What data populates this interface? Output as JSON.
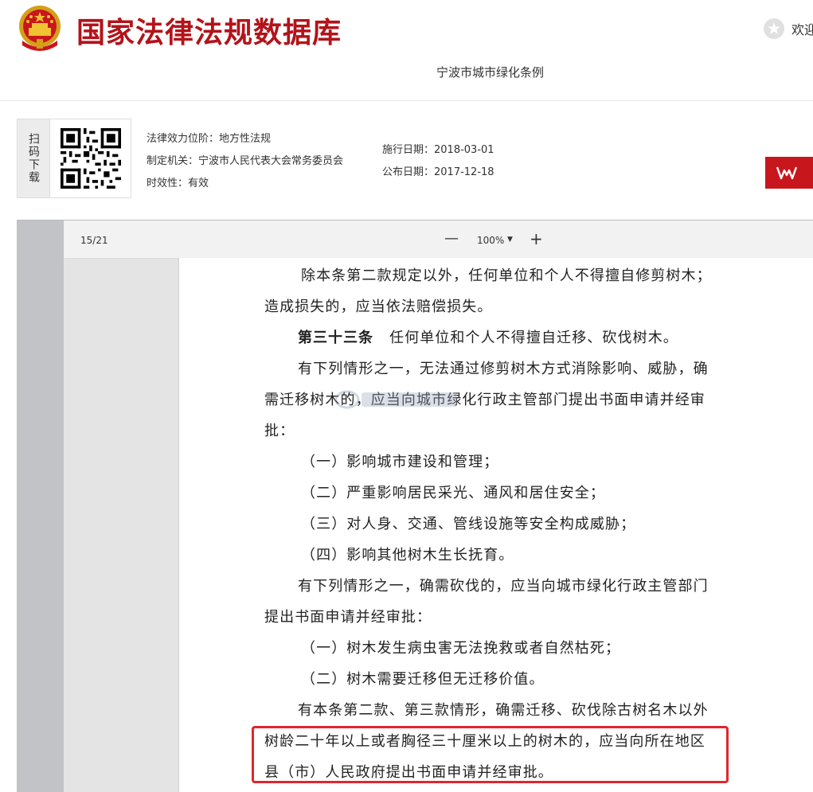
{
  "header": {
    "site_title": "国家法律法规数据库",
    "welcome": "欢迎",
    "doc_title": "宁波市城市绿化条例",
    "emblem_icon": "national-emblem-icon",
    "brand_color": "#b3131a"
  },
  "info": {
    "scan_label": "扫码下载",
    "effect_level": "法律效力位阶：地方性法规",
    "issuing_body": "制定机关：宁波市人民代表大会常务委员会",
    "validity": "时效性：有效",
    "effective_date": "施行日期：2018-03-01",
    "publish_date": "公布日期：2017-12-18",
    "wps_label": "W",
    "wps_color": "#c8161d"
  },
  "viewer": {
    "page_indicator": "15/21",
    "zoom_out": "—",
    "zoom_level": "100%",
    "zoom_in": "+"
  },
  "document": {
    "lines": [
      "除本条第二款规定以外，任何单位和个人不得擅自修剪树木；",
      "造成损失的，应当依法赔偿损失。",
      "任何单位和个人不得擅自迁移、砍伐树木。",
      "有下列情形之一，无法通过修剪树木方式消除影响、威胁，确",
      "需迁移树木的，应当向城市绿化行政主管部门提出书面申请并经审",
      "批：",
      "（一）影响城市建设和管理；",
      "（二）严重影响居民采光、通风和居住安全；",
      "（三）对人身、交通、管线设施等安全构成威胁；",
      "（四）影响其他树木生长抚育。",
      "有下列情形之一，确需砍伐的，应当向城市绿化行政主管部门",
      "提出书面申请并经审批：",
      "（一）树木发生病虫害无法挽救或者自然枯死；",
      "（二）树木需要迁移但无迁移价值。",
      "有本条第二款、第三款情形，确需迁移、砍伐除古树名木以外",
      "树龄二十年以上或者胸径三十厘米以上的树木的，应当向所在地区",
      "县（市）人民政府提出书面申请并经审批。"
    ],
    "article_no": "第三十三条",
    "highlight_color": "#e0262c"
  }
}
